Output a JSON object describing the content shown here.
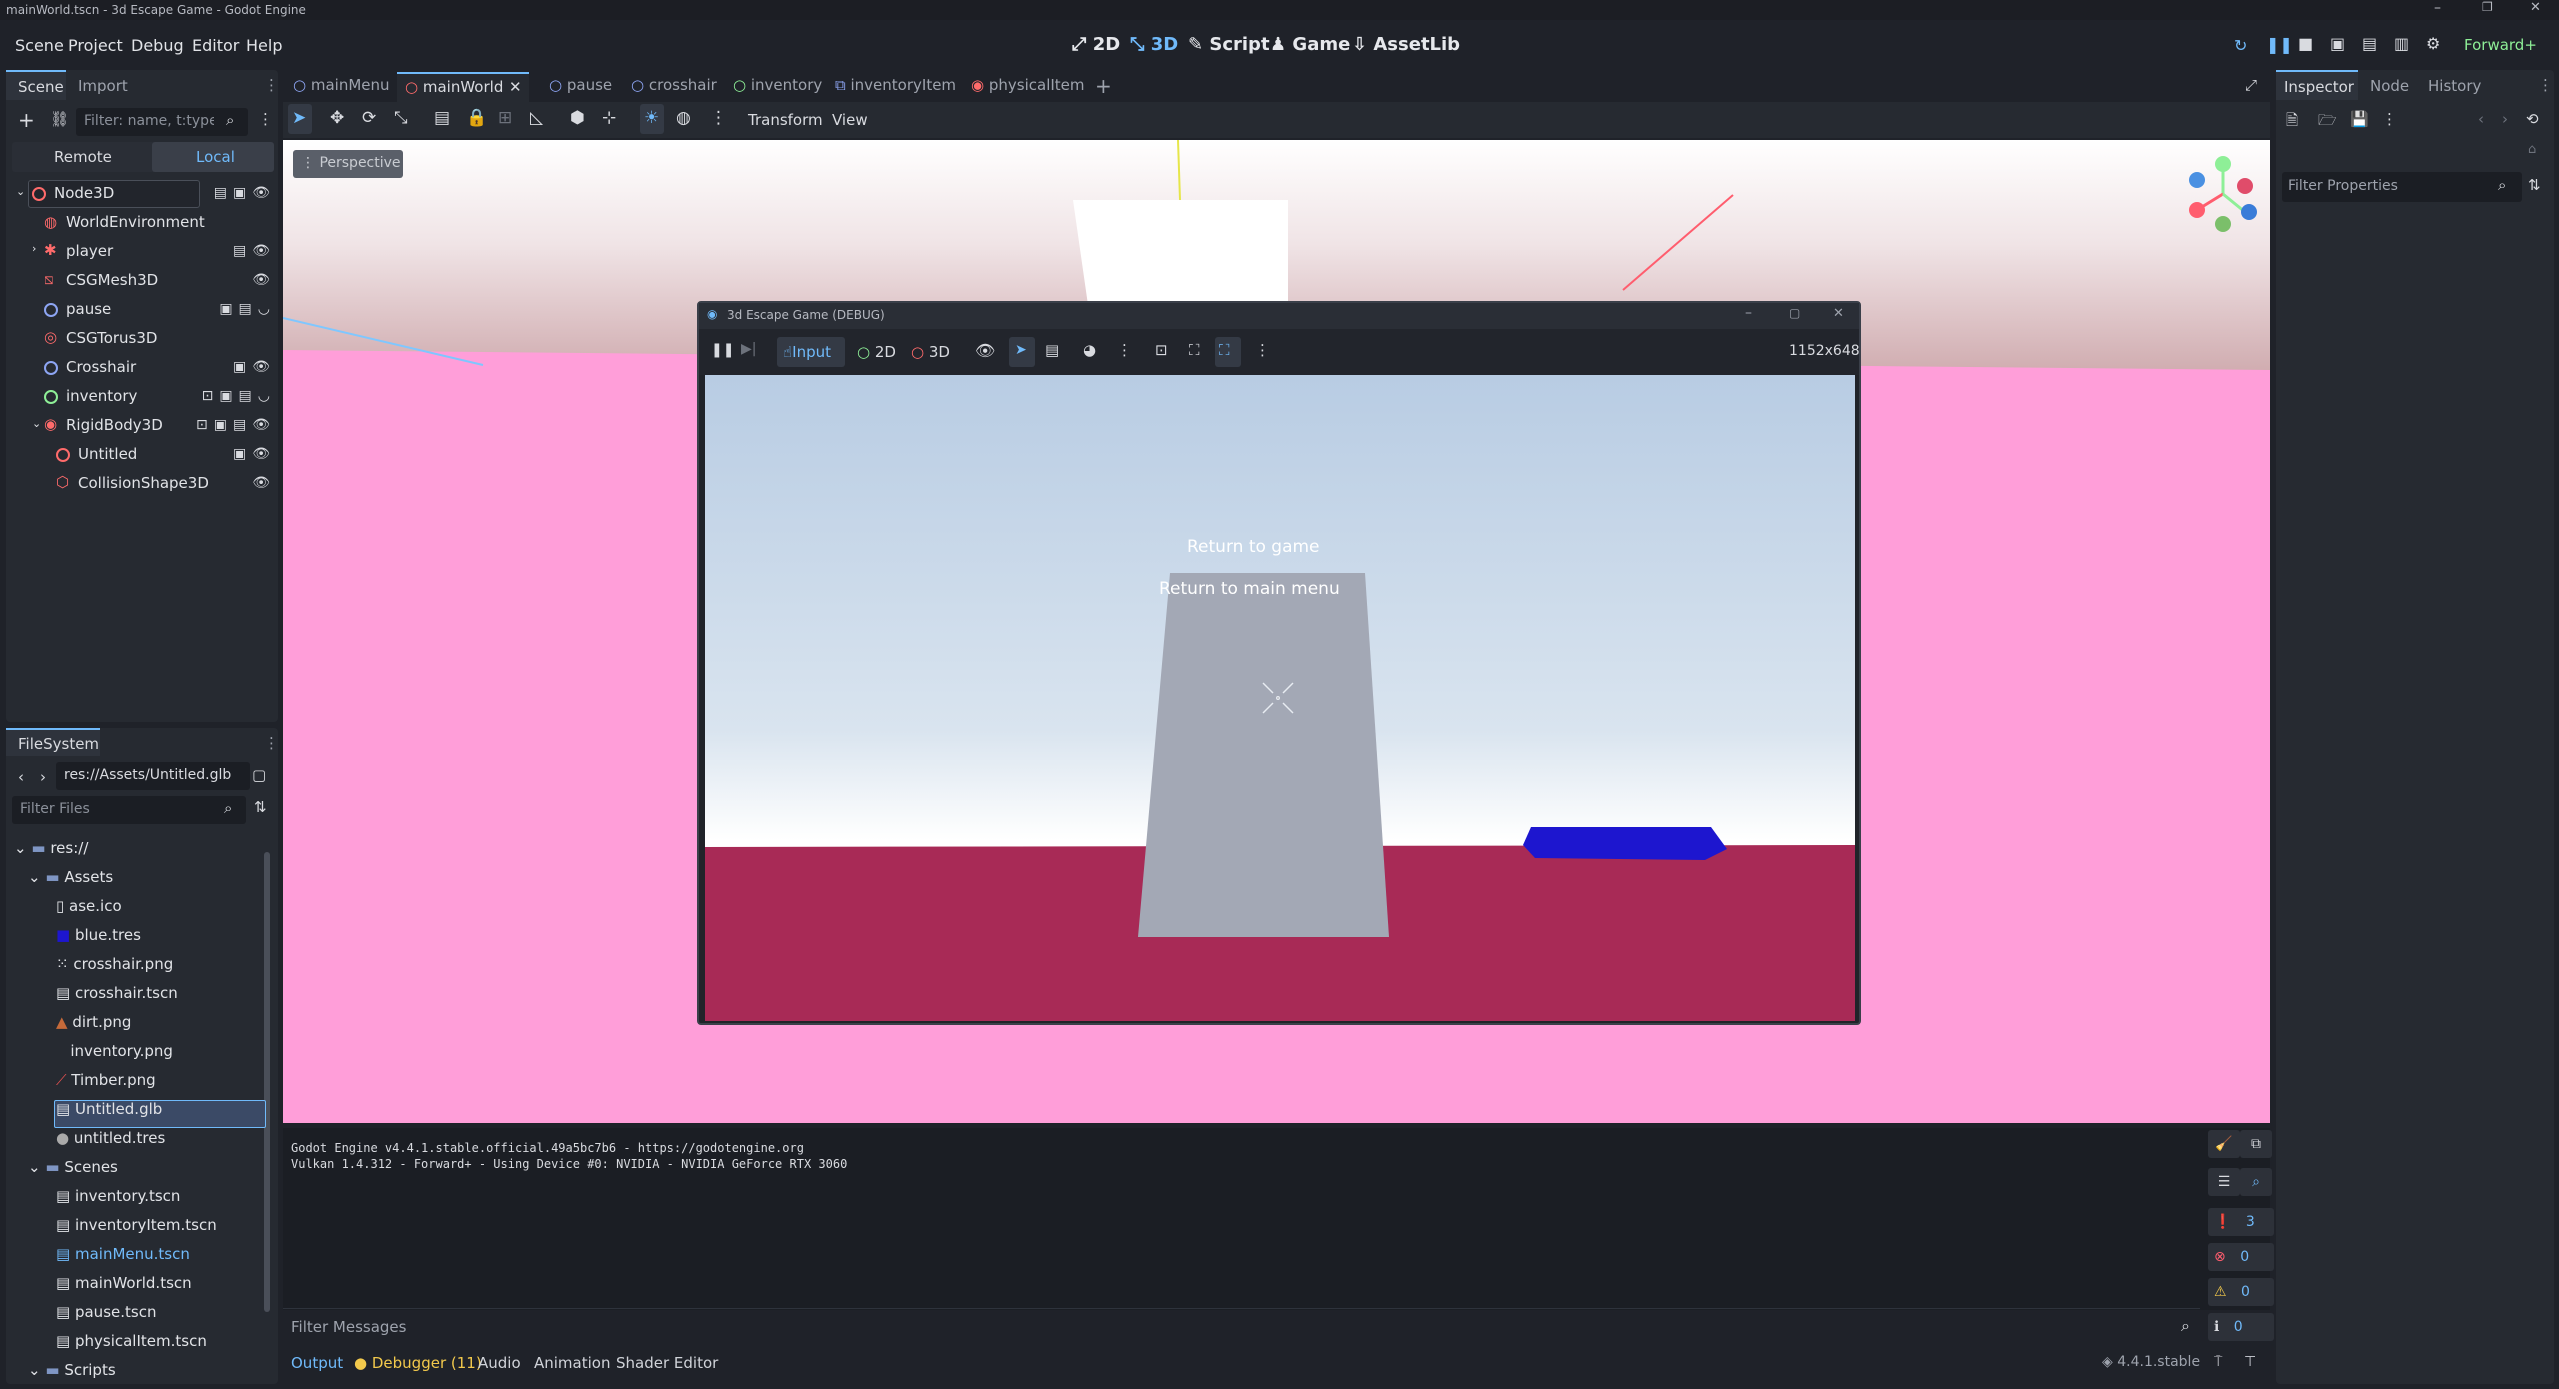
{
  "window": {
    "title": "mainWorld.tscn - 3d Escape Game - Godot Engine"
  },
  "menu": [
    "Scene",
    "Project",
    "Debug",
    "Editor",
    "Help"
  ],
  "workspaces": {
    "w2d": "2D",
    "w3d": "3D",
    "script": "Script",
    "game": "Game",
    "assetlib": "AssetLib"
  },
  "renderer": "Forward+",
  "scene_dock": {
    "tabs": {
      "scene": "Scene",
      "import": "Import"
    },
    "filter_placeholder": "Filter: name, t:type, g:group",
    "remote": "Remote",
    "local": "Local",
    "nodes": [
      {
        "name": "Node3D",
        "color": "#ff6b6b"
      },
      {
        "name": "WorldEnvironment",
        "color": "#ff6b6b"
      },
      {
        "name": "player",
        "color": "#ff6b6b"
      },
      {
        "name": "CSGMesh3D",
        "color": "#ff6b6b"
      },
      {
        "name": "pause",
        "color": "#8da5f3"
      },
      {
        "name": "CSGTorus3D",
        "color": "#ff6b6b"
      },
      {
        "name": "Crosshair",
        "color": "#8da5f3"
      },
      {
        "name": "inventory",
        "color": "#8eef97"
      },
      {
        "name": "RigidBody3D",
        "color": "#ff6b6b"
      },
      {
        "name": "Untitled",
        "color": "#ff6b6b"
      },
      {
        "name": "CollisionShape3D",
        "color": "#ff6b6b"
      }
    ]
  },
  "filesystem": {
    "title": "FileSystem",
    "path": "res://Assets/Untitled.glb",
    "filter_placeholder": "Filter Files",
    "items": [
      {
        "label": "res://"
      },
      {
        "label": "Assets"
      },
      {
        "label": "ase.ico"
      },
      {
        "label": "blue.tres"
      },
      {
        "label": "crosshair.png"
      },
      {
        "label": "crosshair.tscn"
      },
      {
        "label": "dirt.png"
      },
      {
        "label": "inventory.png"
      },
      {
        "label": "Timber.png"
      },
      {
        "label": "Untitled.glb"
      },
      {
        "label": "untitled.tres"
      },
      {
        "label": "Scenes"
      },
      {
        "label": "inventory.tscn"
      },
      {
        "label": "inventoryItem.tscn"
      },
      {
        "label": "mainMenu.tscn"
      },
      {
        "label": "mainWorld.tscn"
      },
      {
        "label": "pause.tscn"
      },
      {
        "label": "physicalItem.tscn"
      },
      {
        "label": "Scripts"
      }
    ]
  },
  "scene_tabs": [
    "mainMenu",
    "mainWorld",
    "pause",
    "crosshair",
    "inventory",
    "inventoryItem",
    "physicalItem"
  ],
  "viewport_toolbar": {
    "transform": "Transform",
    "view": "View",
    "perspective": "Perspective"
  },
  "game_window": {
    "title": "3d Escape Game (DEBUG)",
    "input": "Input",
    "mode_2d": "2D",
    "mode_3d": "3D",
    "resolution": "1152x648",
    "menu_return_game": "Return to game",
    "menu_return_main": "Return to main menu"
  },
  "output": {
    "line1": "Godot Engine v4.4.1.stable.official.49a5bc7b6 - https://godotengine.org",
    "line2": "Vulkan 1.4.312 - Forward+ - Using Device #0: NVIDIA - NVIDIA GeForce RTX 3060",
    "filter_placeholder": "Filter Messages",
    "counts": {
      "messages": "3",
      "errors": "0",
      "warnings": "0",
      "info": "0"
    }
  },
  "bottom_tabs": [
    "Output",
    "Debugger (11)",
    "Audio",
    "Animation",
    "Shader Editor"
  ],
  "version": "4.4.1.stable",
  "inspector": {
    "tabs": [
      "Inspector",
      "Node",
      "History"
    ],
    "filter_placeholder": "Filter Properties"
  },
  "colors": {
    "accent": "#70bafa",
    "pink_floor": "#ff9ed9",
    "game_floor": "#a82a56",
    "sky": "#b8cce3",
    "blue_object": "#1d16cf"
  }
}
